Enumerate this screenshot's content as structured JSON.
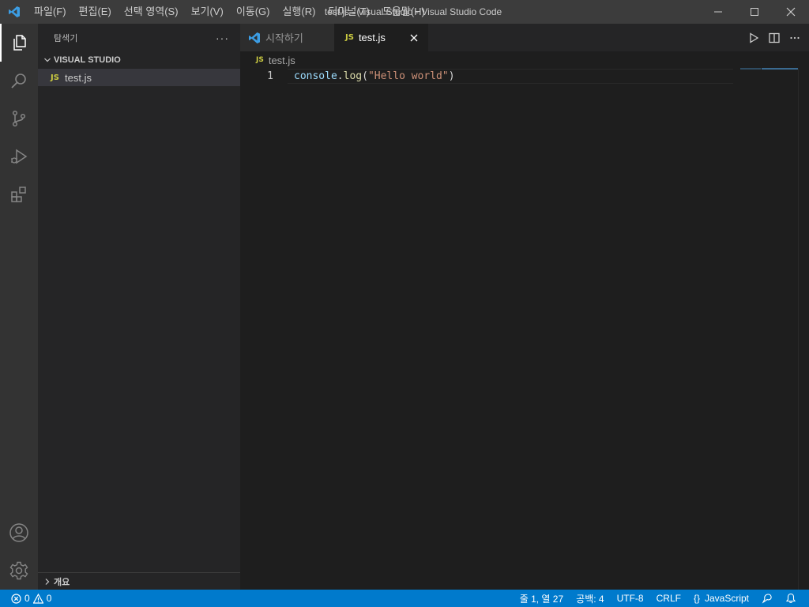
{
  "window": {
    "title": "test.js - Visual Studio - Visual Studio Code"
  },
  "menu": [
    "파일(F)",
    "편집(E)",
    "선택 영역(S)",
    "보기(V)",
    "이동(G)",
    "실행(R)",
    "터미널(T)",
    "도움말(H)"
  ],
  "activity_bar": {
    "items": [
      "explorer-icon",
      "search-icon",
      "source-control-icon",
      "run-debug-icon",
      "extensions-icon"
    ],
    "bottom_items": [
      "account-icon",
      "settings-gear-icon"
    ]
  },
  "sidebar": {
    "title": "탐색기",
    "more": "···",
    "folder": "VISUAL STUDIO",
    "files": [
      {
        "badge": "JS",
        "name": "test.js"
      }
    ],
    "outline": "개요"
  },
  "tabs": [
    {
      "label": "시작하기",
      "icon": "vscode-icon",
      "active": false
    },
    {
      "label": "test.js",
      "icon": "JS",
      "active": true
    }
  ],
  "breadcrumb": {
    "badge": "JS",
    "file": "test.js"
  },
  "editor": {
    "lines": [
      {
        "number": "1",
        "tokens": [
          "console",
          ".",
          "log",
          "(",
          "\"Hello world\"",
          ")"
        ]
      }
    ]
  },
  "status_bar": {
    "errors": "0",
    "warnings": "0",
    "position": "줄 1, 열 27",
    "spaces": "공백: 4",
    "encoding": "UTF-8",
    "eol": "CRLF",
    "language_braces": "{}",
    "language": "JavaScript"
  },
  "colors": {
    "accent": "#007acc",
    "js_badge": "#cbcb41",
    "vscode_blue": "#3c9ee5"
  }
}
